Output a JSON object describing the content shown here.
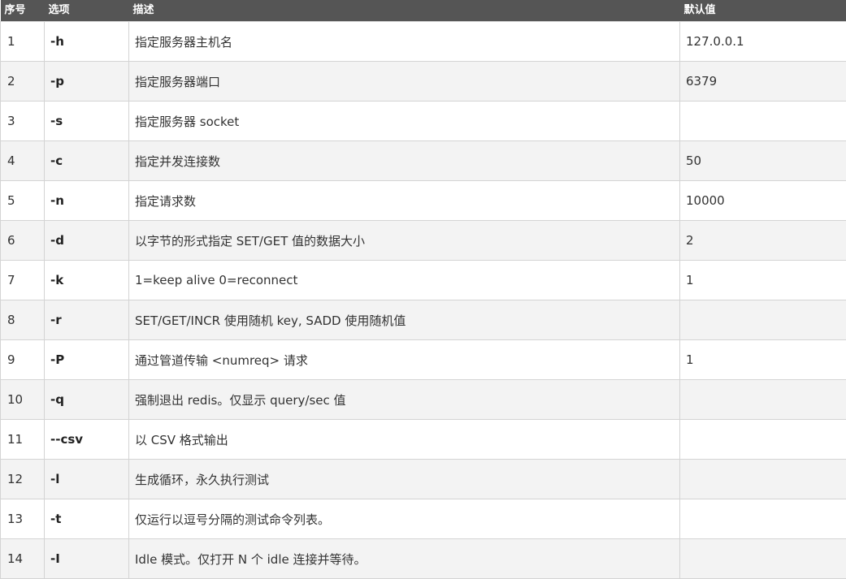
{
  "colors": {
    "header_bg": "#555555",
    "header_text": "#ffffff",
    "row_alt_bg": "#f3f3f3",
    "border": "#d4d4d4"
  },
  "table": {
    "headers": [
      "序号",
      "选项",
      "描述",
      "默认值"
    ],
    "rows": [
      {
        "no": "1",
        "option": "-h",
        "desc": "指定服务器主机名",
        "default": "127.0.0.1"
      },
      {
        "no": "2",
        "option": "-p",
        "desc": "指定服务器端口",
        "default": "6379"
      },
      {
        "no": "3",
        "option": "-s",
        "desc": "指定服务器 socket",
        "default": ""
      },
      {
        "no": "4",
        "option": "-c",
        "desc": "指定并发连接数",
        "default": "50"
      },
      {
        "no": "5",
        "option": "-n",
        "desc": "指定请求数",
        "default": "10000"
      },
      {
        "no": "6",
        "option": "-d",
        "desc": "以字节的形式指定 SET/GET 值的数据大小",
        "default": "2"
      },
      {
        "no": "7",
        "option": "-k",
        "desc": "1=keep alive 0=reconnect",
        "default": "1"
      },
      {
        "no": "8",
        "option": "-r",
        "desc": "SET/GET/INCR 使用随机 key, SADD 使用随机值",
        "default": ""
      },
      {
        "no": "9",
        "option": "-P",
        "desc": "通过管道传输 <numreq> 请求",
        "default": "1"
      },
      {
        "no": "10",
        "option": "-q",
        "desc": "强制退出 redis。仅显示 query/sec 值",
        "default": ""
      },
      {
        "no": "11",
        "option": "--csv",
        "desc": "以 CSV 格式输出",
        "default": ""
      },
      {
        "no": "12",
        "option": "-l",
        "desc": "生成循环，永久执行测试",
        "default": ""
      },
      {
        "no": "13",
        "option": "-t",
        "desc": "仅运行以逗号分隔的测试命令列表。",
        "default": ""
      },
      {
        "no": "14",
        "option": "-I",
        "desc": "Idle 模式。仅打开 N 个 idle 连接并等待。",
        "default": ""
      }
    ]
  }
}
